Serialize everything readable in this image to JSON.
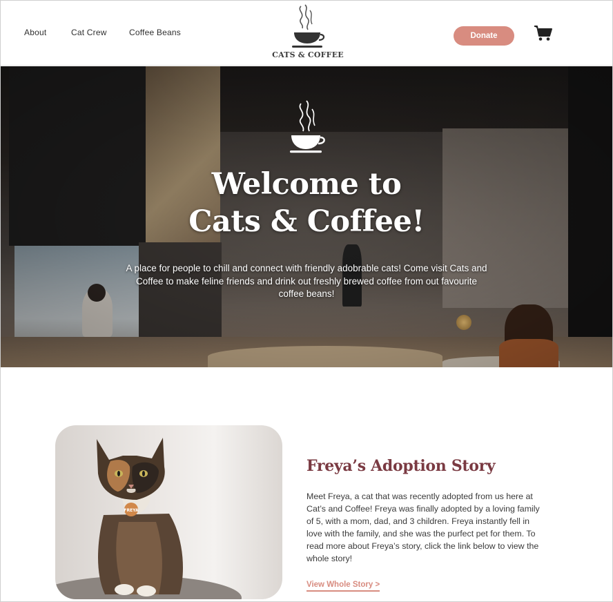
{
  "nav": {
    "links": [
      "About",
      "Cat Crew",
      "Coffee Beans"
    ],
    "logo_text": "CATS & COFFEE",
    "donate_label": "Donate",
    "cart_icon": "shopping-cart-icon"
  },
  "hero": {
    "icon": "coffee-cup-icon",
    "title_line1": "Welcome to",
    "title_line2": "Cats & Coffee!",
    "subtitle": "A place for people to chill and connect with friendly adobrable cats! Come visit Cats and Coffee to make feline friends and drink out freshly brewed coffee from out favourite coffee beans!"
  },
  "story": {
    "title": "Freya’s Adoption Story",
    "body": "Meet Freya, a cat that was recently adopted from us here at Cat’s and Coffee! Freya was finally adopted by a loving family of 5, with a mom, dad, and 3 children. Freya instantly fell in love with the family, and she was the purfect pet for them. To read more about Freya’s story, click the link below to view the whole story!",
    "link_label": "View Whole Story >",
    "tag_text": "FREYA"
  },
  "colors": {
    "accent": "#d88c80",
    "story_title": "#7a3a42"
  }
}
